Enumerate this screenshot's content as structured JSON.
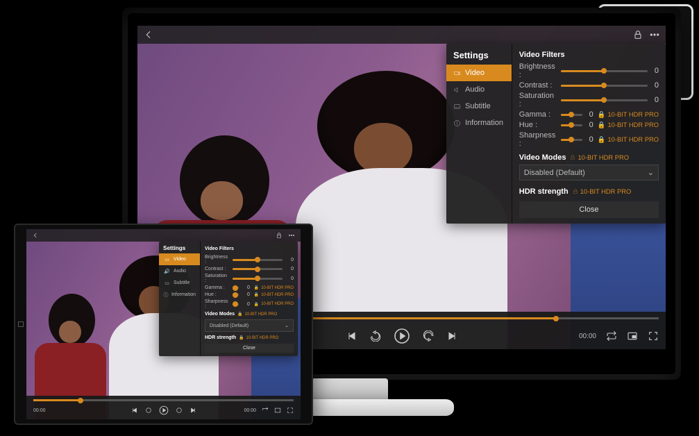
{
  "settings_title": "Settings",
  "tabs": {
    "video": "Video",
    "audio": "Audio",
    "subtitle": "Subtitle",
    "information": "Information"
  },
  "video_filters": {
    "heading": "Video Filters",
    "items": [
      {
        "label": "Brightness :",
        "value": "0",
        "pct": 50,
        "pro": false
      },
      {
        "label": "Contrast :",
        "value": "0",
        "pct": 50,
        "pro": false
      },
      {
        "label": "Saturation :",
        "value": "0",
        "pct": 50,
        "pro": false
      },
      {
        "label": "Gamma :",
        "value": "0",
        "pct": 50,
        "pro": true
      },
      {
        "label": "Hue :",
        "value": "0",
        "pct": 50,
        "pro": true
      },
      {
        "label": "Sharpness :",
        "value": "0",
        "pct": 50,
        "pro": true
      }
    ]
  },
  "pro_label": "10-BIT HDR  PRO",
  "video_modes": {
    "heading": "Video Modes",
    "selected": "Disabled (Default)"
  },
  "hdr": {
    "heading": "HDR strength"
  },
  "close_label": "Close",
  "player": {
    "time_current": "00:00",
    "time_total": "00:00",
    "progress_pct": 80
  }
}
